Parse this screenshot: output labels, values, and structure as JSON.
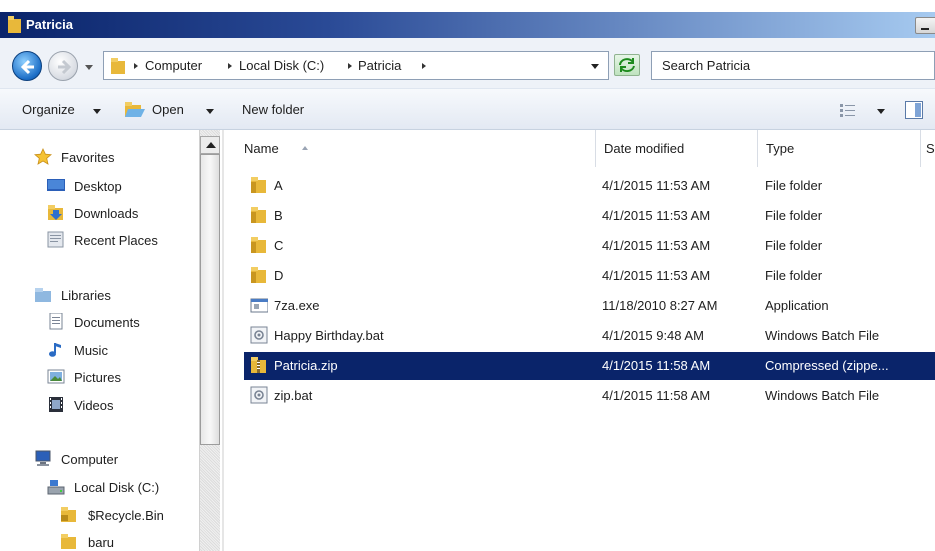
{
  "window": {
    "title": "Patricia"
  },
  "address": {
    "crumbs": [
      "Computer",
      "Local Disk (C:)",
      "Patricia"
    ],
    "search_placeholder": "Search Patricia"
  },
  "toolbar": {
    "organize": "Organize",
    "open": "Open",
    "new_folder": "New folder"
  },
  "nav": {
    "favorites": {
      "label": "Favorites",
      "items": [
        "Desktop",
        "Downloads",
        "Recent Places"
      ]
    },
    "libraries": {
      "label": "Libraries",
      "items": [
        "Documents",
        "Music",
        "Pictures",
        "Videos"
      ]
    },
    "computer": {
      "label": "Computer",
      "items": [
        "Local Disk (C:)",
        "$Recycle.Bin",
        "baru"
      ]
    }
  },
  "columns": {
    "name": "Name",
    "date": "Date modified",
    "type": "Type",
    "size": "S"
  },
  "files": [
    {
      "name": "A",
      "date": "4/1/2015 11:53 AM",
      "type": "File folder",
      "icon": "folder-icon"
    },
    {
      "name": "B",
      "date": "4/1/2015 11:53 AM",
      "type": "File folder",
      "icon": "folder-icon"
    },
    {
      "name": "C",
      "date": "4/1/2015 11:53 AM",
      "type": "File folder",
      "icon": "folder-icon"
    },
    {
      "name": "D",
      "date": "4/1/2015 11:53 AM",
      "type": "File folder",
      "icon": "folder-icon"
    },
    {
      "name": "7za.exe",
      "date": "11/18/2010 8:27 AM",
      "type": "Application",
      "icon": "application-icon"
    },
    {
      "name": "Happy Birthday.bat",
      "date": "4/1/2015 9:48 AM",
      "type": "Windows Batch File",
      "icon": "batch-file-icon"
    },
    {
      "name": "Patricia.zip",
      "date": "4/1/2015 11:58 AM",
      "type": "Compressed (zippe...",
      "icon": "zip-folder-icon",
      "selected": true
    },
    {
      "name": "zip.bat",
      "date": "4/1/2015 11:58 AM",
      "type": "Windows Batch File",
      "icon": "batch-file-icon"
    }
  ],
  "colors": {
    "selection": "#0a246a",
    "titlebar": "#0a246a"
  }
}
